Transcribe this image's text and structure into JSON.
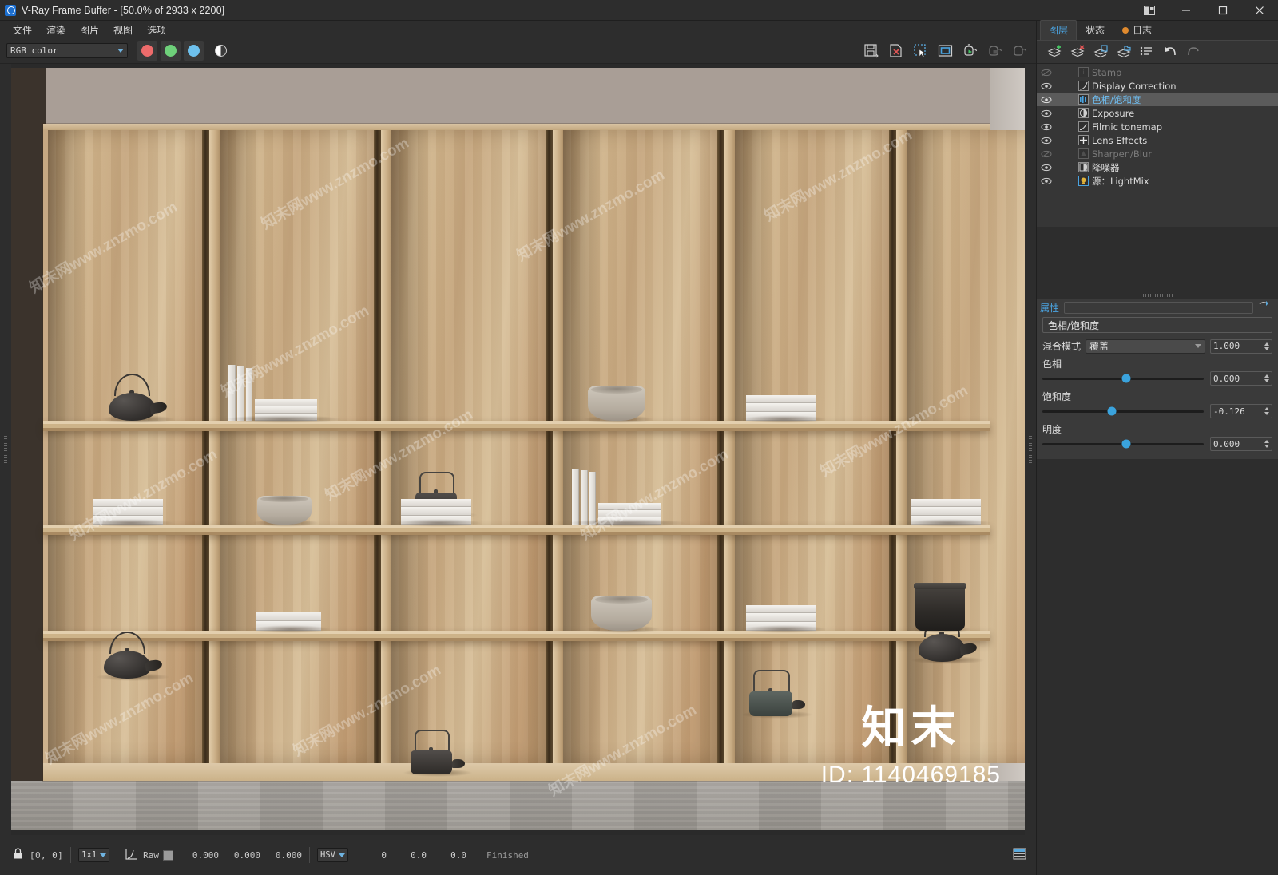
{
  "window": {
    "title": "V-Ray Frame Buffer - [50.0% of 2933 x 2200]",
    "logo_icon": "vray-logo-icon",
    "controls": {
      "layout_icon": "dock-layout-icon",
      "minimize_icon": "minimize-icon",
      "maximize_icon": "maximize-icon",
      "close_icon": "close-icon"
    }
  },
  "menubar": {
    "items": [
      {
        "label": "文件"
      },
      {
        "label": "渲染"
      },
      {
        "label": "图片"
      },
      {
        "label": "视图"
      },
      {
        "label": "选项"
      }
    ]
  },
  "toolbar": {
    "channel": {
      "value": "RGB color",
      "caret_icon": "chevron-down-icon"
    },
    "rgb": [
      {
        "name": "red-channel-toggle",
        "color": "#ed6b6b"
      },
      {
        "name": "green-channel-toggle",
        "color": "#6ed07a"
      },
      {
        "name": "blue-channel-toggle",
        "color": "#6ec1ed"
      }
    ],
    "mono_toggle": "monochrome-toggle",
    "right_buttons": [
      {
        "name": "save-image-icon",
        "disabled": false
      },
      {
        "name": "clear-image-icon",
        "disabled": false
      },
      {
        "name": "region-select-icon",
        "disabled": false
      },
      {
        "name": "fit-frame-icon",
        "disabled": false
      },
      {
        "name": "start-render-icon",
        "disabled": false
      },
      {
        "name": "stop-render-icon",
        "disabled": true
      },
      {
        "name": "resume-render-icon",
        "disabled": true
      }
    ]
  },
  "statusbar": {
    "lock_icon": "lock-icon",
    "coordinates": "[0,  0]",
    "sample_size": "1x1",
    "curve_icon": "curve-icon",
    "mode_label": "Raw",
    "color_swatch": "#9a9a9a",
    "values": [
      "0.000",
      "0.000",
      "0.000"
    ],
    "color_space": "HSV",
    "hsv_values": [
      "0",
      "0.0",
      "0.0"
    ],
    "status": "Finished",
    "panel_toggle_icon": "toggle-panel-icon"
  },
  "right_panel": {
    "tabs": [
      {
        "label": "图层",
        "active": true,
        "dot": false
      },
      {
        "label": "状态",
        "active": false,
        "dot": false
      },
      {
        "label": "日志",
        "active": false,
        "dot": true
      }
    ],
    "toolbar": [
      {
        "name": "add-layer-icon",
        "disabled": false
      },
      {
        "name": "delete-layer-icon",
        "disabled": false
      },
      {
        "name": "save-layer-icon",
        "disabled": false
      },
      {
        "name": "load-layer-icon",
        "disabled": false
      },
      {
        "name": "layer-list-icon",
        "disabled": false
      },
      {
        "name": "undo-icon",
        "disabled": false
      },
      {
        "name": "redo-icon",
        "disabled": true
      }
    ],
    "layers": [
      {
        "label": "Stamp",
        "visible": false,
        "enabled": false,
        "selected": false,
        "icon": "stamp-icon"
      },
      {
        "label": "Display Correction",
        "visible": true,
        "enabled": true,
        "selected": false,
        "icon": "curve-icon"
      },
      {
        "label": "色相/饱和度",
        "visible": true,
        "enabled": true,
        "selected": true,
        "icon": "hue-sat-icon"
      },
      {
        "label": "Exposure",
        "visible": true,
        "enabled": true,
        "selected": false,
        "icon": "exposure-icon"
      },
      {
        "label": "Filmic tonemap",
        "visible": true,
        "enabled": true,
        "selected": false,
        "icon": "tonemap-icon"
      },
      {
        "label": "Lens Effects",
        "visible": true,
        "enabled": true,
        "selected": false,
        "icon": "lens-effects-icon"
      },
      {
        "label": "Sharpen/Blur",
        "visible": false,
        "enabled": false,
        "selected": false,
        "icon": "sharpen-blur-icon"
      },
      {
        "label": "降噪器",
        "visible": true,
        "enabled": true,
        "selected": false,
        "icon": "denoiser-icon"
      },
      {
        "label": "源：LightMix",
        "visible": true,
        "enabled": true,
        "selected": false,
        "icon": "lightmix-icon"
      }
    ],
    "properties": {
      "header": "属性",
      "header_icon": "properties-menu-icon",
      "layer_name": "色相/饱和度",
      "blend_mode_label": "混合模式",
      "blend_mode_value": "覆盖",
      "blend_amount": "1.000",
      "sliders": [
        {
          "label": "色相",
          "value": "0.000",
          "pos": 52
        },
        {
          "label": "饱和度",
          "value": "-0.126",
          "pos": 43
        },
        {
          "label": "明度",
          "value": "0.000",
          "pos": 52
        }
      ]
    }
  },
  "render_image": {
    "description": "Interior render of a six-bay oak display shelf unit against a warm grey wall with grey wood floor",
    "zoom": "50.0%",
    "resolution": "2933 x 2200",
    "colors": {
      "wall": "#a99e96",
      "wood_light": "#d4ba94",
      "wood_mid": "#c5a77e",
      "wood_dark": "#3a2c1b",
      "floor": "#a8a49f",
      "object_dark": "#2e2b28",
      "object_stone": "#b7aea2",
      "object_paper": "#efece7"
    },
    "bays": [
      {
        "index": 1,
        "items": [
          {
            "shelf": "top",
            "type": "teapot-round",
            "name": "dark-round-teapot"
          },
          {
            "shelf": "middle",
            "type": "books-stack",
            "name": "white-book-stack",
            "count": 3
          },
          {
            "shelf": "lower",
            "type": "teapot-round",
            "name": "dark-round-teapot"
          }
        ]
      },
      {
        "index": 2,
        "items": [
          {
            "shelf": "top",
            "type": "books-upright",
            "name": "upright-books-with-stack",
            "count": 3
          },
          {
            "shelf": "middle",
            "type": "bowl",
            "name": "stone-bowl"
          },
          {
            "shelf": "lower",
            "type": "books-stack",
            "name": "white-book-stack",
            "count": 2
          }
        ]
      },
      {
        "index": 3,
        "items": [
          {
            "shelf": "top",
            "type": "teapot-square",
            "name": "dark-square-teapot"
          },
          {
            "shelf": "middle",
            "type": "books-stack",
            "name": "white-book-stack",
            "count": 3
          },
          {
            "shelf": "lower",
            "type": "teapot-square",
            "name": "dark-square-teapot"
          }
        ]
      },
      {
        "index": 4,
        "items": [
          {
            "shelf": "top",
            "type": "bowl",
            "name": "stone-bowl"
          },
          {
            "shelf": "middle",
            "type": "books-upright",
            "name": "upright-books-with-stack",
            "count": 3
          },
          {
            "shelf": "lower",
            "type": "bowl",
            "name": "stone-bowl"
          }
        ]
      },
      {
        "index": 5,
        "items": [
          {
            "shelf": "top",
            "type": "books-stack",
            "name": "white-book-stack",
            "count": 3
          },
          {
            "shelf": "middle",
            "type": "teapot-square",
            "name": "green-square-teapot"
          },
          {
            "shelf": "lower",
            "type": "books-stack",
            "name": "white-book-stack",
            "count": 3
          }
        ]
      },
      {
        "index": 6,
        "items": [
          {
            "shelf": "top",
            "type": "teapot-round",
            "name": "dark-round-teapot"
          },
          {
            "shelf": "middle",
            "type": "books-stack",
            "name": "white-book-stack",
            "count": 3
          },
          {
            "shelf": "lower",
            "type": "dark-pot",
            "name": "dark-metal-pot"
          }
        ]
      }
    ],
    "watermarks": {
      "tiled_text": "知末网www.znzmo.com",
      "brand_cn": "知末",
      "brand_id": "ID: 1140469185"
    }
  }
}
